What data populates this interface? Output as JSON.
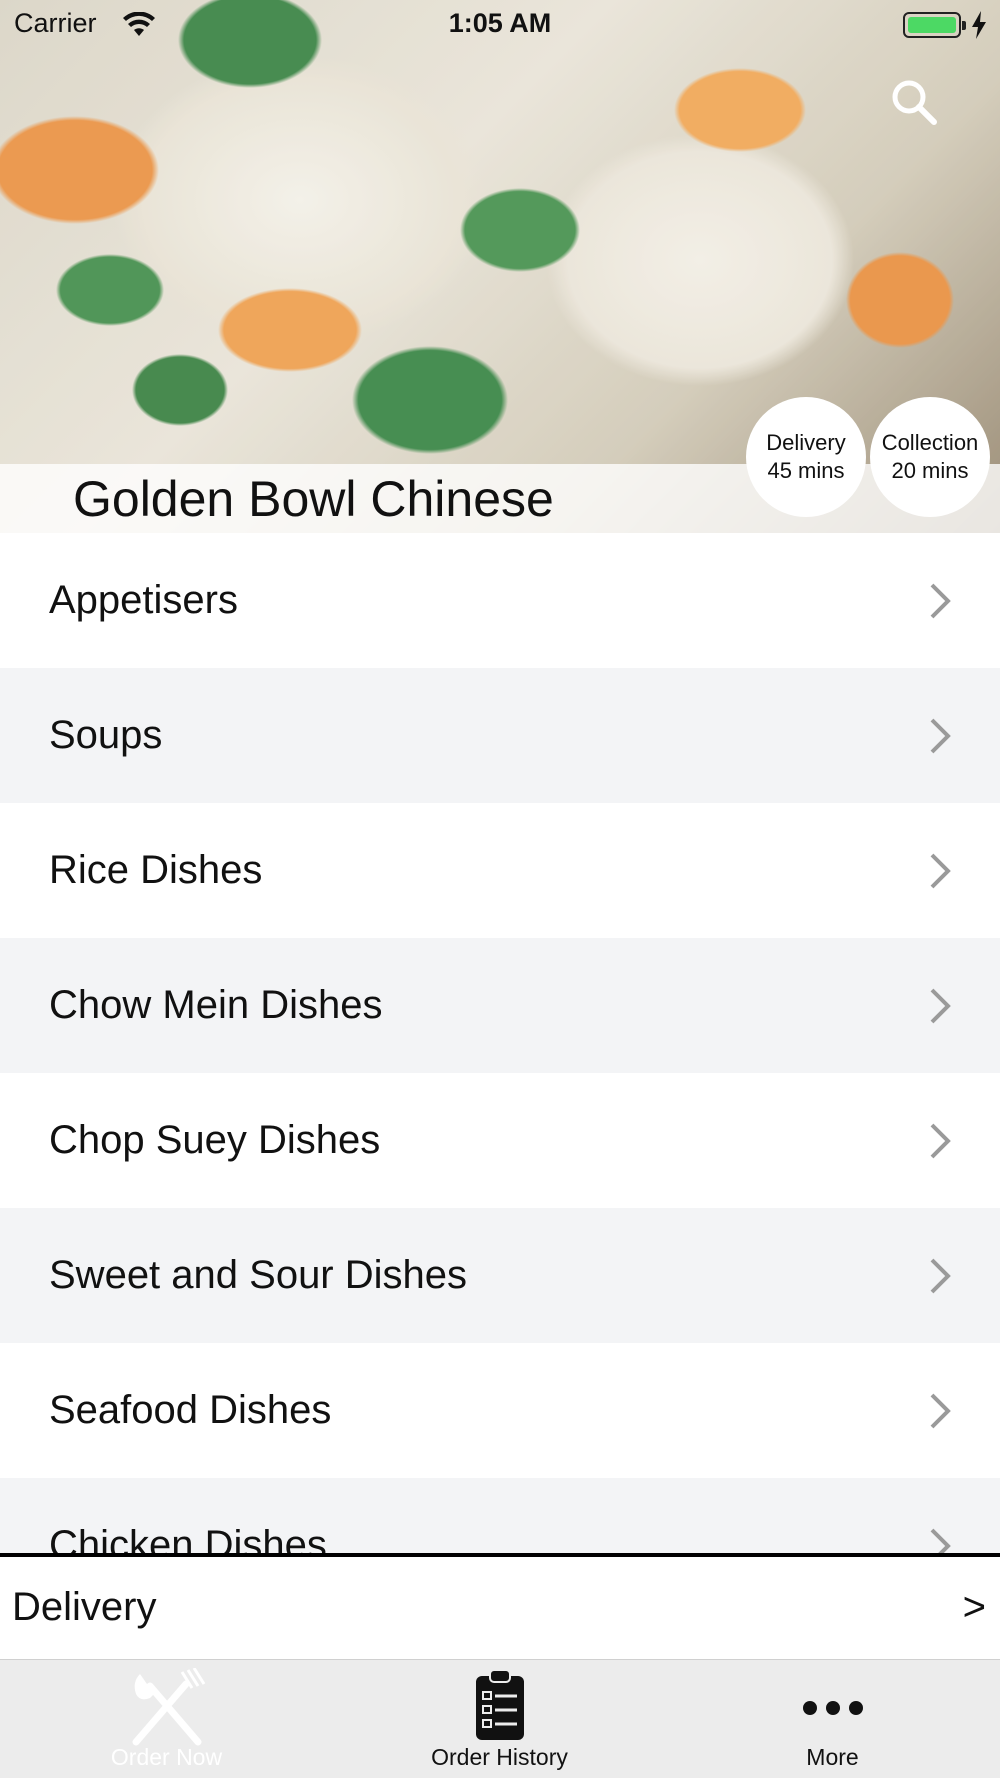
{
  "status_bar": {
    "carrier": "Carrier",
    "time": "1:05 AM",
    "icons": [
      "wifi-icon",
      "battery-icon",
      "charging-bolt-icon"
    ],
    "battery_color": "#4cd964"
  },
  "header": {
    "restaurant_name": "Golden Bowl Chinese",
    "search_icon": "search-icon",
    "delivery_badge": {
      "line1": "Delivery",
      "line2": "45 mins"
    },
    "collection_badge": {
      "line1": "Collection",
      "line2": "20 mins"
    }
  },
  "menu": {
    "categories": [
      {
        "label": "Appetisers"
      },
      {
        "label": "Soups"
      },
      {
        "label": "Rice Dishes"
      },
      {
        "label": "Chow Mein Dishes"
      },
      {
        "label": "Chop Suey Dishes"
      },
      {
        "label": "Sweet and Sour Dishes"
      },
      {
        "label": "Seafood Dishes"
      },
      {
        "label": "Chicken Dishes"
      }
    ],
    "row_colors": {
      "odd": "#ffffff",
      "even": "#f3f4f6"
    }
  },
  "order_mode": {
    "label": "Delivery",
    "arrow": ">"
  },
  "tab_bar": {
    "tabs": [
      {
        "label": "Order Now",
        "icon": "fork-knife-icon",
        "active": true
      },
      {
        "label": "Order History",
        "icon": "clipboard-list-icon",
        "active": false
      },
      {
        "label": "More",
        "icon": "more-dots-icon",
        "active": false
      }
    ]
  }
}
